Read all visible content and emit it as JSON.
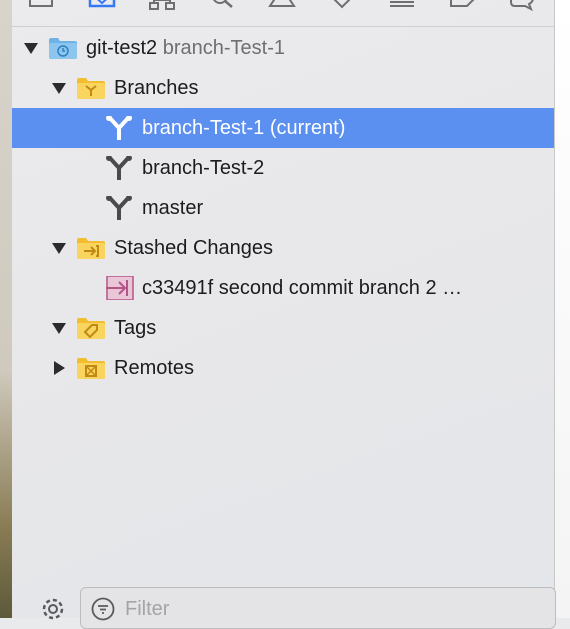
{
  "toolbar": {
    "icons": [
      "folder-icon",
      "source-control-icon",
      "hierarchy-icon",
      "search-icon",
      "warning-icon",
      "test-icon",
      "debug-icon",
      "breakpoint-icon",
      "report-icon"
    ]
  },
  "tree": {
    "repo": {
      "name": "git-test2",
      "branch": "branch-Test-1"
    },
    "branches_label": "Branches",
    "branches": [
      {
        "name": "branch-Test-1 (current)"
      },
      {
        "name": "branch-Test-2"
      },
      {
        "name": "master"
      }
    ],
    "stashed_label": "Stashed Changes",
    "stash_item": "c33491f second commit branch 2 …",
    "tags_label": "Tags",
    "remotes_label": "Remotes"
  },
  "filter": {
    "placeholder": "Filter"
  },
  "colors": {
    "selection": "#5b8ff0",
    "folder": "#f7cf4f",
    "repo_folder": "#6fb3e6",
    "stash_icon": "#b5548a"
  }
}
